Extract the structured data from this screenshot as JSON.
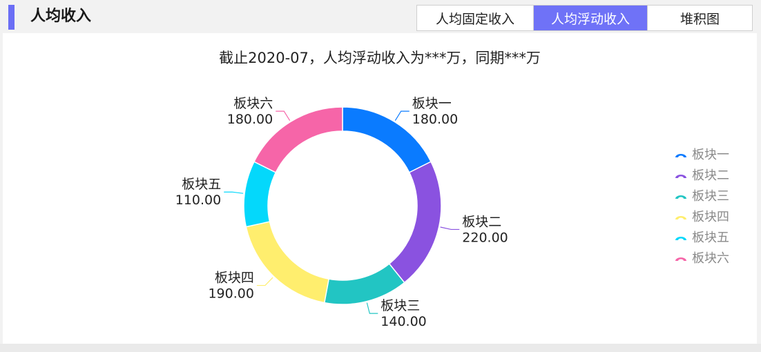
{
  "header": {
    "title": "人均收入",
    "tabs": [
      {
        "label": "人均固定收入",
        "active": false
      },
      {
        "label": "人均浮动收入",
        "active": true
      },
      {
        "label": "堆积图",
        "active": false
      }
    ]
  },
  "colors": {
    "accent": "#6b6ef5",
    "active_tab": "#6f72f7"
  },
  "chart_data": {
    "type": "pie",
    "variant": "donut",
    "title": "截止2020-07，人均浮动收入为***万，同期***万",
    "legend_position": "right",
    "slices": [
      {
        "name": "板块一",
        "value": 180,
        "label": "180.00",
        "color": "#0a7bff"
      },
      {
        "name": "板块二",
        "value": 220,
        "label": "220.00",
        "color": "#8a52e0"
      },
      {
        "name": "板块三",
        "value": 140,
        "label": "140.00",
        "color": "#22c5c3"
      },
      {
        "name": "板块四",
        "value": 190,
        "label": "190.00",
        "color": "#ffee6e"
      },
      {
        "name": "板块五",
        "value": 110,
        "label": "110.00",
        "color": "#04d8fb"
      },
      {
        "name": "板块六",
        "value": 180,
        "label": "180.00",
        "color": "#f665a8"
      }
    ]
  }
}
